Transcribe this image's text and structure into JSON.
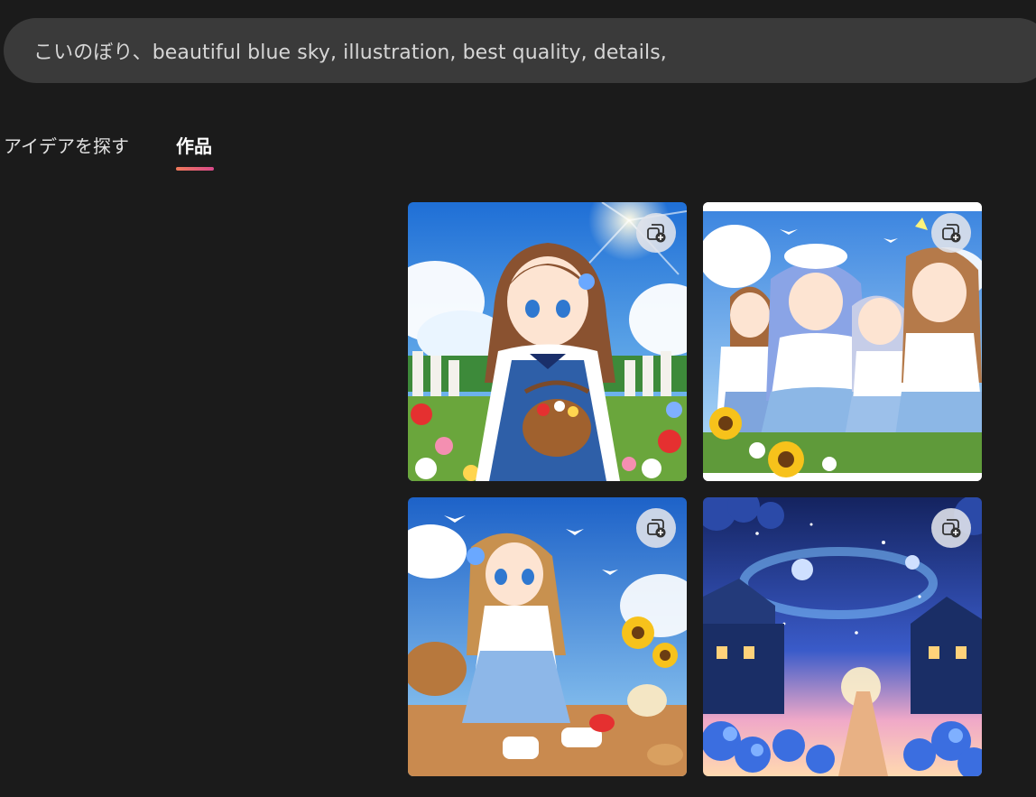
{
  "prompt": {
    "text": "こいのぼり、beautiful blue sky, illustration, best quality, details,"
  },
  "tabs": [
    {
      "label": "アイデアを探す",
      "active": false
    },
    {
      "label": "作品",
      "active": true
    }
  ],
  "accent_gradient": [
    "#f07a5a",
    "#d94a8c"
  ],
  "gallery": {
    "items": [
      {
        "subject": "girl-with-flower-basket",
        "action_icon": "add-to-collection-icon"
      },
      {
        "subject": "four-girls-sunflowers",
        "action_icon": "add-to-collection-icon"
      },
      {
        "subject": "girl-picnic-sunflowers",
        "action_icon": "add-to-collection-icon"
      },
      {
        "subject": "starry-night-town",
        "action_icon": "add-to-collection-icon"
      }
    ]
  }
}
